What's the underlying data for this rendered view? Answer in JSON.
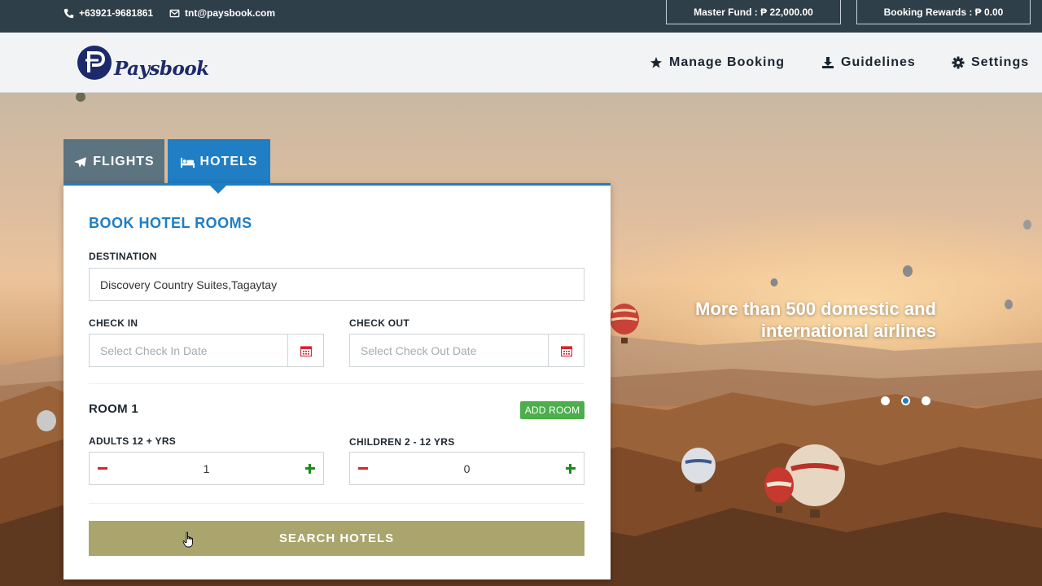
{
  "topbar": {
    "phone": "+63921-9681861",
    "email": "tnt@paysbook.com",
    "master_fund": "Master Fund : ₱ 22,000.00",
    "booking_rewards": "Booking Rewards : ₱ 0.00"
  },
  "header": {
    "brand": "Paysbook",
    "nav": [
      {
        "label": "Manage Booking",
        "icon": "star-icon"
      },
      {
        "label": "Guidelines",
        "icon": "download-icon"
      },
      {
        "label": "Settings",
        "icon": "gear-icon"
      }
    ]
  },
  "tabs": {
    "flights": "FLIGHTS",
    "hotels": "HOTELS",
    "active": "hotels"
  },
  "form": {
    "title": "BOOK HOTEL ROOMS",
    "destination_label": "DESTINATION",
    "destination_value": "Discovery Country Suites,Tagaytay",
    "checkin_label": "CHECK IN",
    "checkin_placeholder": "Select Check In Date",
    "checkout_label": "CHECK OUT",
    "checkout_placeholder": "Select Check Out Date",
    "room_title": "ROOM 1",
    "add_room": "ADD ROOM",
    "adults_label": "ADULTS 12 + YRS",
    "adults_value": "1",
    "children_label": "CHILDREN 2 - 12 YRS",
    "children_value": "0",
    "search_button": "SEARCH HOTELS"
  },
  "hero": {
    "tagline_line1": "More than 500 domestic and",
    "tagline_line2": "international airlines",
    "slides": 3,
    "active_slide": 2
  },
  "colors": {
    "topbar": "#2f3f49",
    "accent": "#1f7ec4",
    "tab_inactive": "#5c7380",
    "search_button": "#a9a56c",
    "add_room": "#4cae4c"
  }
}
